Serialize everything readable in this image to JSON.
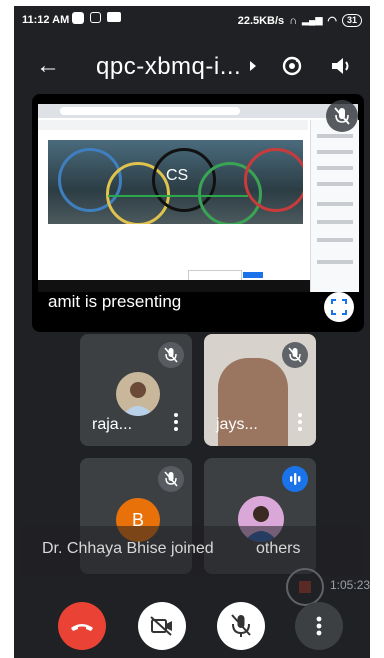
{
  "status_bar": {
    "time": "11:12 AM",
    "network_speed": "22.5KB/s",
    "battery": "31"
  },
  "header": {
    "meeting_code": "qpc-xbmq-i..."
  },
  "presentation": {
    "caption": "amit is presenting",
    "slide_banner_text": "CS"
  },
  "participants": [
    {
      "name": "raja...",
      "muted": true
    },
    {
      "name": "jays...",
      "muted": true
    },
    {
      "initial": "B",
      "muted": true
    },
    {
      "speaking": true
    }
  ],
  "toast": {
    "message": "Dr. Chhaya Bhise joined",
    "others": "others"
  },
  "recording": {
    "elapsed": "1:05:23"
  },
  "colors": {
    "background": "#202124",
    "tile": "#3c4043",
    "end_call": "#ea4335",
    "accent_blue": "#1a73e8"
  },
  "icons": {
    "back": "arrow-left-icon",
    "switch_camera": "switch-camera-icon",
    "audio": "speaker-icon",
    "mic_off": "mic-off-icon",
    "fullscreen": "fullscreen-icon",
    "end_call": "phone-hangup-icon",
    "camera_off": "video-off-icon",
    "more": "more-vert-icon"
  }
}
